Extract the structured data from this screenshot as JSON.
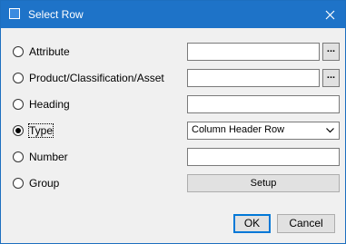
{
  "window": {
    "title": "Select Row"
  },
  "rows": [
    {
      "label": "Attribute",
      "selected": false
    },
    {
      "label": "Product/Classification/Asset",
      "selected": false
    },
    {
      "label": "Heading",
      "selected": false
    },
    {
      "label": "Type",
      "selected": true
    },
    {
      "label": "Number",
      "selected": false
    },
    {
      "label": "Group",
      "selected": false
    }
  ],
  "attribute_field": {
    "value": "",
    "browse_label": "..."
  },
  "product_field": {
    "value": "",
    "browse_label": "..."
  },
  "heading_field": {
    "value": ""
  },
  "type_select": {
    "selected": "Column Header Row"
  },
  "number_field": {
    "value": ""
  },
  "group_button": {
    "label": "Setup"
  },
  "footer": {
    "ok_label": "OK",
    "cancel_label": "Cancel"
  },
  "icons": {
    "window": "window-icon",
    "close": "close-icon",
    "dropdown": "chevron-down-icon"
  },
  "colors": {
    "titlebar": "#1e73c8",
    "background": "#f0f0f0",
    "focus": "#0078d7"
  }
}
